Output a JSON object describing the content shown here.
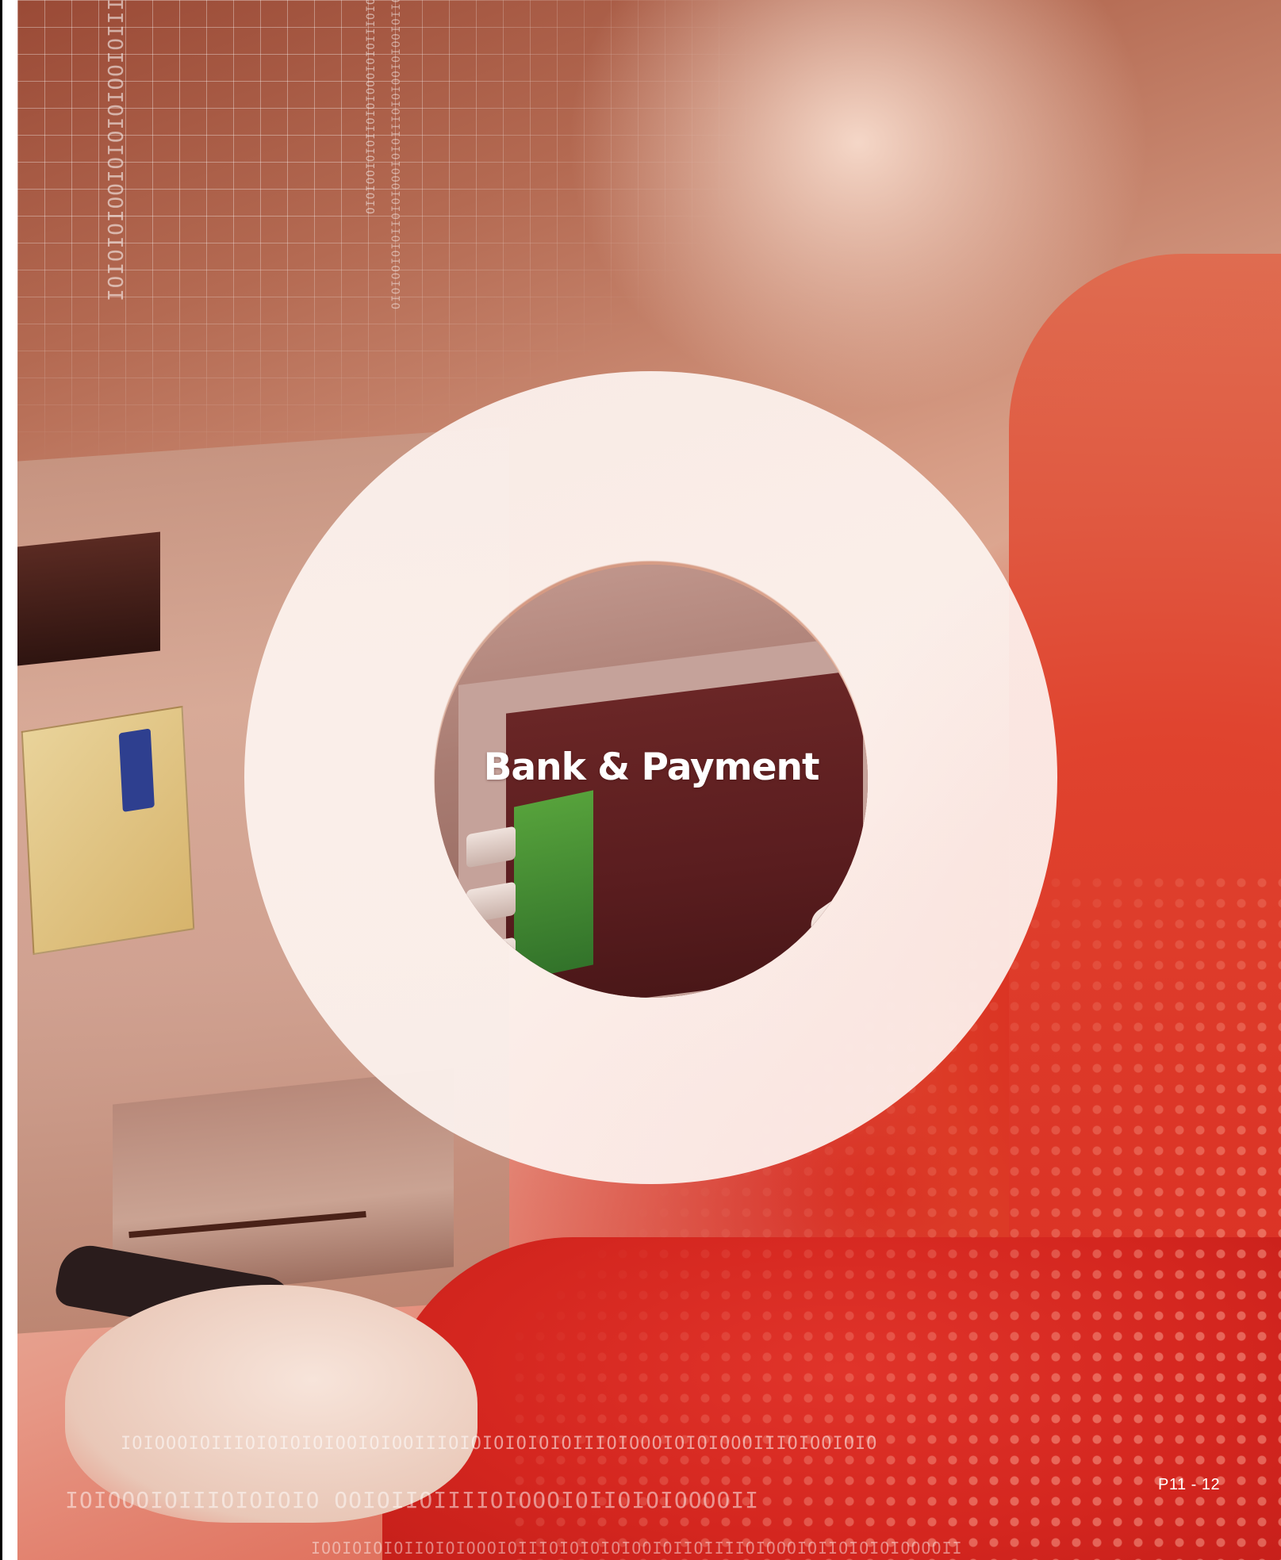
{
  "cover": {
    "title": "Bank & Payment",
    "page_number": "P11 - 12"
  },
  "colors": {
    "accent_red": "#d8271f",
    "ring_white": "#fdf4f0",
    "title_text": "#ffffff"
  }
}
